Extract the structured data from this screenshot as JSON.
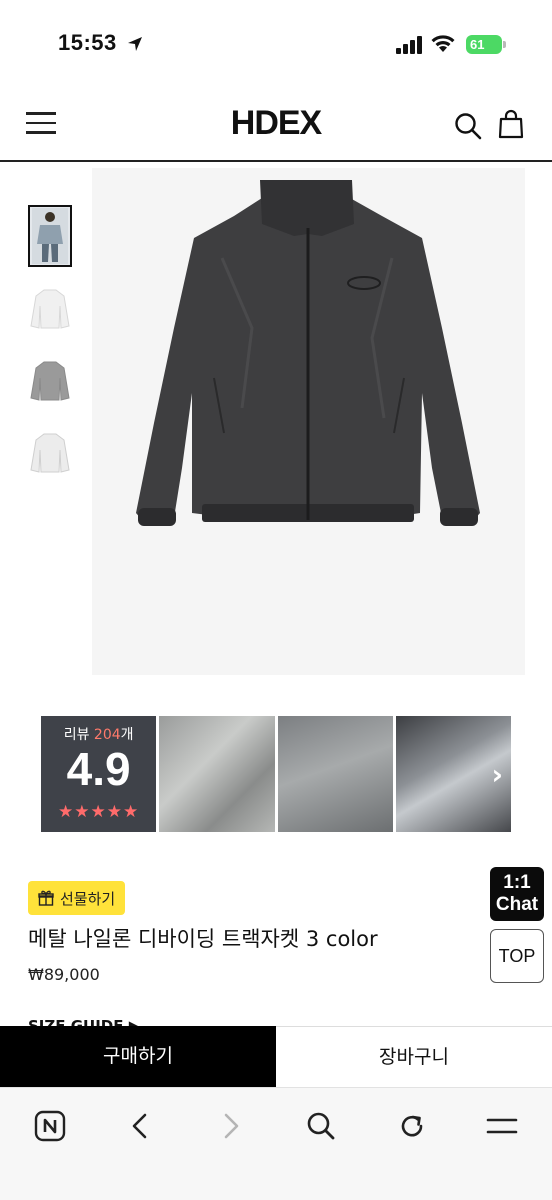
{
  "status_bar": {
    "time": "15:53",
    "battery": "61"
  },
  "header": {
    "logo": "HDEX"
  },
  "reviews": {
    "label": "리뷰",
    "count": "204",
    "unit": "개",
    "score": "4.9",
    "stars": "★★★★★"
  },
  "product": {
    "gift_label": "선물하기",
    "title": "메탈 나일론 디바이딩 트랙자켓 3 color",
    "price": "₩89,000",
    "size_guide": "SIZE GUIDE ▶"
  },
  "floating": {
    "chat_line1": "1:1",
    "chat_line2": "Chat",
    "top": "TOP"
  },
  "actions": {
    "buy": "구매하기",
    "cart": "장바구니"
  },
  "colors": {
    "accent": "#ffe23a",
    "buy_bg": "#000000",
    "battery": "#4cd964",
    "review_count": "#ff7a6b"
  },
  "icons": [
    "location-arrow-icon",
    "signal-icon",
    "wifi-icon",
    "battery-icon",
    "menu-icon",
    "search-icon",
    "bag-icon",
    "gift-icon",
    "chevron-right-icon",
    "naver-home-icon",
    "back-icon",
    "forward-icon",
    "reload-icon",
    "tabs-menu-icon"
  ]
}
